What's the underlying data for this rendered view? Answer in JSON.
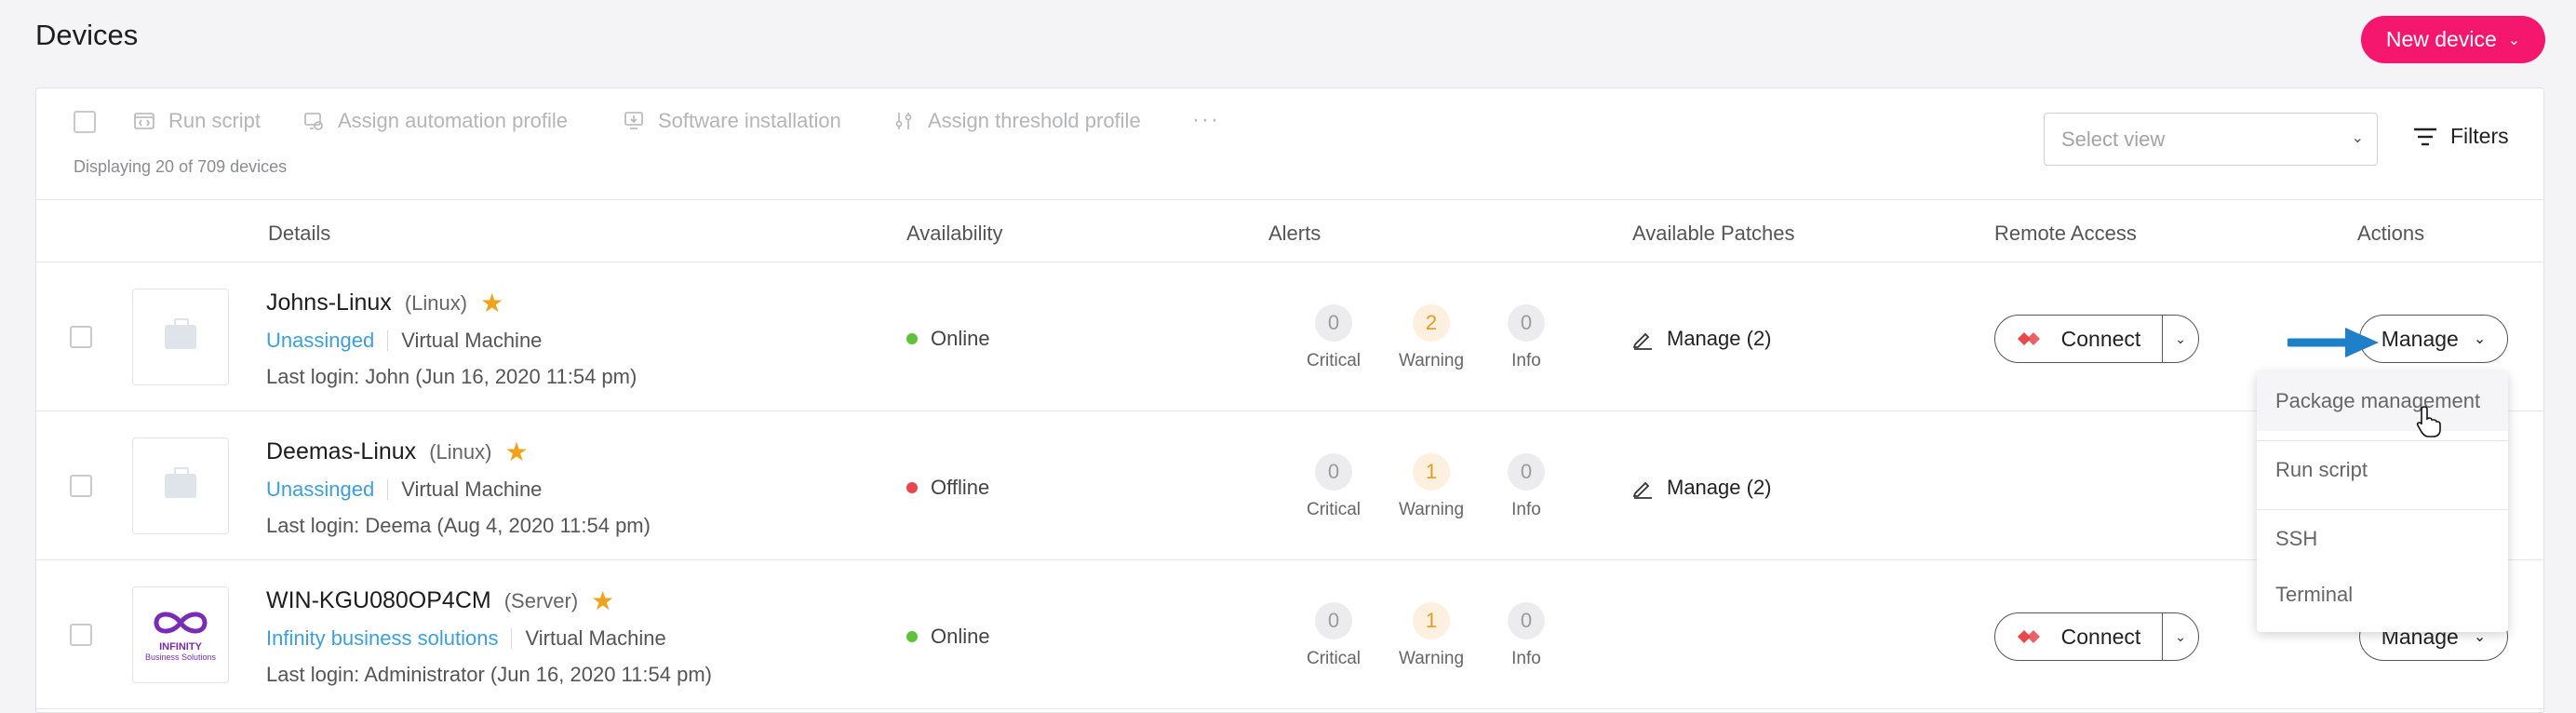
{
  "page": {
    "title": "Devices",
    "new_device_label": "New device"
  },
  "toolbar": {
    "actions": [
      {
        "label": "Run script",
        "icon": "code-window-icon"
      },
      {
        "label": "Assign automation profile",
        "icon": "automation-icon"
      },
      {
        "label": "Software installation",
        "icon": "download-monitor-icon"
      },
      {
        "label": "Assign threshold profile",
        "icon": "sliders-icon"
      }
    ],
    "more_label": "···",
    "displaying": "Displaying 20 of 709 devices",
    "select_view_placeholder": "Select view",
    "filters_label": "Filters"
  },
  "columns": {
    "details": "Details",
    "availability": "Availability",
    "alerts": "Alerts",
    "patches": "Available Patches",
    "remote": "Remote Access",
    "actions": "Actions"
  },
  "alert_labels": {
    "critical": "Critical",
    "warning": "Warning",
    "info": "Info"
  },
  "devices": [
    {
      "name": "Johns-Linux",
      "os": "(Linux)",
      "starred": true,
      "org": "Unassinged",
      "type": "Virtual Machine",
      "last_login": "Last login: John (Jun 16, 2020 11:54 pm)",
      "availability": "Online",
      "availability_color": "#5cc33b",
      "alerts": {
        "critical": "0",
        "warning": "2",
        "info": "0"
      },
      "patches": "Manage (2)",
      "connect_label": "Connect",
      "manage_label": "Manage"
    },
    {
      "name": "Deemas-Linux",
      "os": "(Linux)",
      "starred": true,
      "org": "Unassinged",
      "type": "Virtual Machine",
      "last_login": "Last login: Deema (Aug 4, 2020 11:54 pm)",
      "availability": "Offline",
      "availability_color": "#e8474b",
      "alerts": {
        "critical": "0",
        "warning": "1",
        "info": "0"
      },
      "patches": "Manage (2)"
    },
    {
      "name": "WIN-KGU080OP4CM",
      "os": "(Server)",
      "starred": true,
      "org": "Infinity business solutions",
      "type": "Virtual Machine",
      "last_login": "Last login: Administrator (Jun 16, 2020 11:54 pm)",
      "availability": "Online",
      "availability_color": "#5cc33b",
      "alerts": {
        "critical": "0",
        "warning": "1",
        "info": "0"
      },
      "connect_label": "Connect",
      "manage_label": "Manage",
      "logo": {
        "line1": "INFINITY",
        "line2": "Business Solutions"
      }
    }
  ],
  "manage_menu": {
    "items": [
      "Package management",
      "Run script",
      "SSH",
      "Terminal"
    ]
  },
  "colors": {
    "accent": "#f5166d",
    "link": "#3aa0dd",
    "star": "#f0a21a",
    "arrow": "#1f7fc8"
  }
}
